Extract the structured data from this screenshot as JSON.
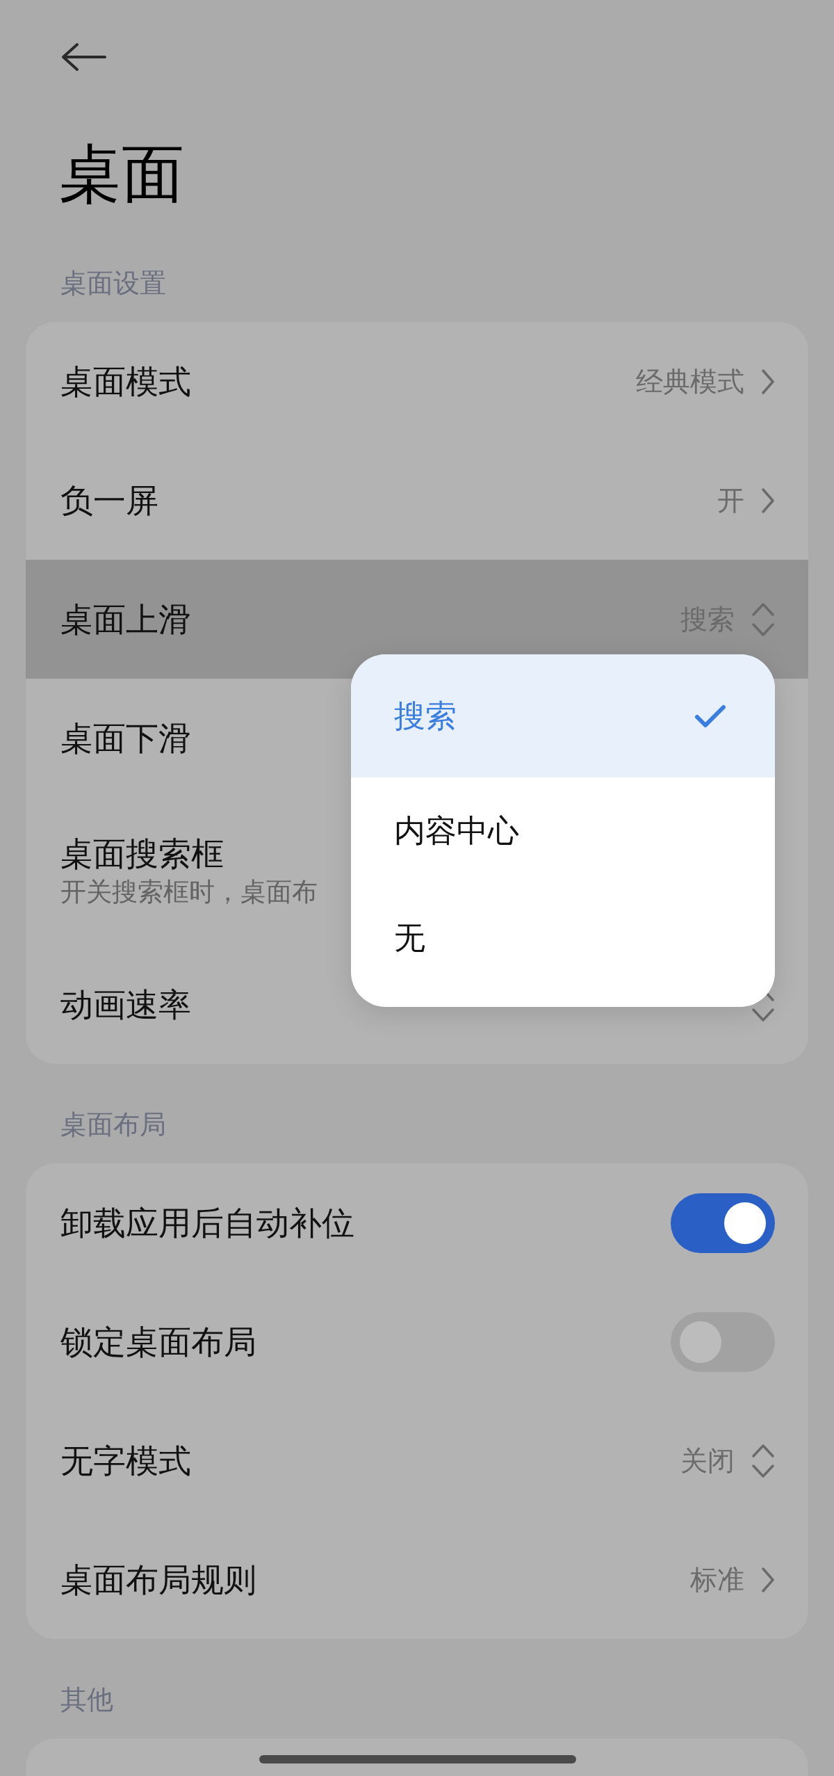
{
  "header": {
    "title": "桌面"
  },
  "sections": [
    {
      "title": "桌面设置",
      "rows": [
        {
          "kind": "link",
          "label": "桌面模式",
          "value": "经典模式",
          "pressed": false
        },
        {
          "kind": "link",
          "label": "负一屏",
          "value": "开",
          "pressed": false
        },
        {
          "kind": "select",
          "label": "桌面上滑",
          "value": "搜索",
          "pressed": true
        },
        {
          "kind": "plain",
          "label": "桌面下滑",
          "pressed": false
        },
        {
          "kind": "plain",
          "label": "桌面搜索框",
          "subtitle": "开关搜索框时，桌面布",
          "pressed": false
        },
        {
          "kind": "select",
          "label": "动画速率",
          "pressed": false
        }
      ]
    },
    {
      "title": "桌面布局",
      "rows": [
        {
          "kind": "switch",
          "label": "卸载应用后自动补位",
          "on": true,
          "pressed": false
        },
        {
          "kind": "switch",
          "label": "锁定桌面布局",
          "on": false,
          "pressed": false
        },
        {
          "kind": "select",
          "label": "无字模式",
          "value": "关闭",
          "pressed": false
        },
        {
          "kind": "link",
          "label": "桌面布局规则",
          "value": "标准",
          "pressed": false
        }
      ]
    },
    {
      "title": "其他"
    }
  ],
  "popup": {
    "options": [
      {
        "label": "搜索",
        "selected": true
      },
      {
        "label": "内容中心",
        "selected": false
      },
      {
        "label": "无",
        "selected": false
      }
    ]
  }
}
